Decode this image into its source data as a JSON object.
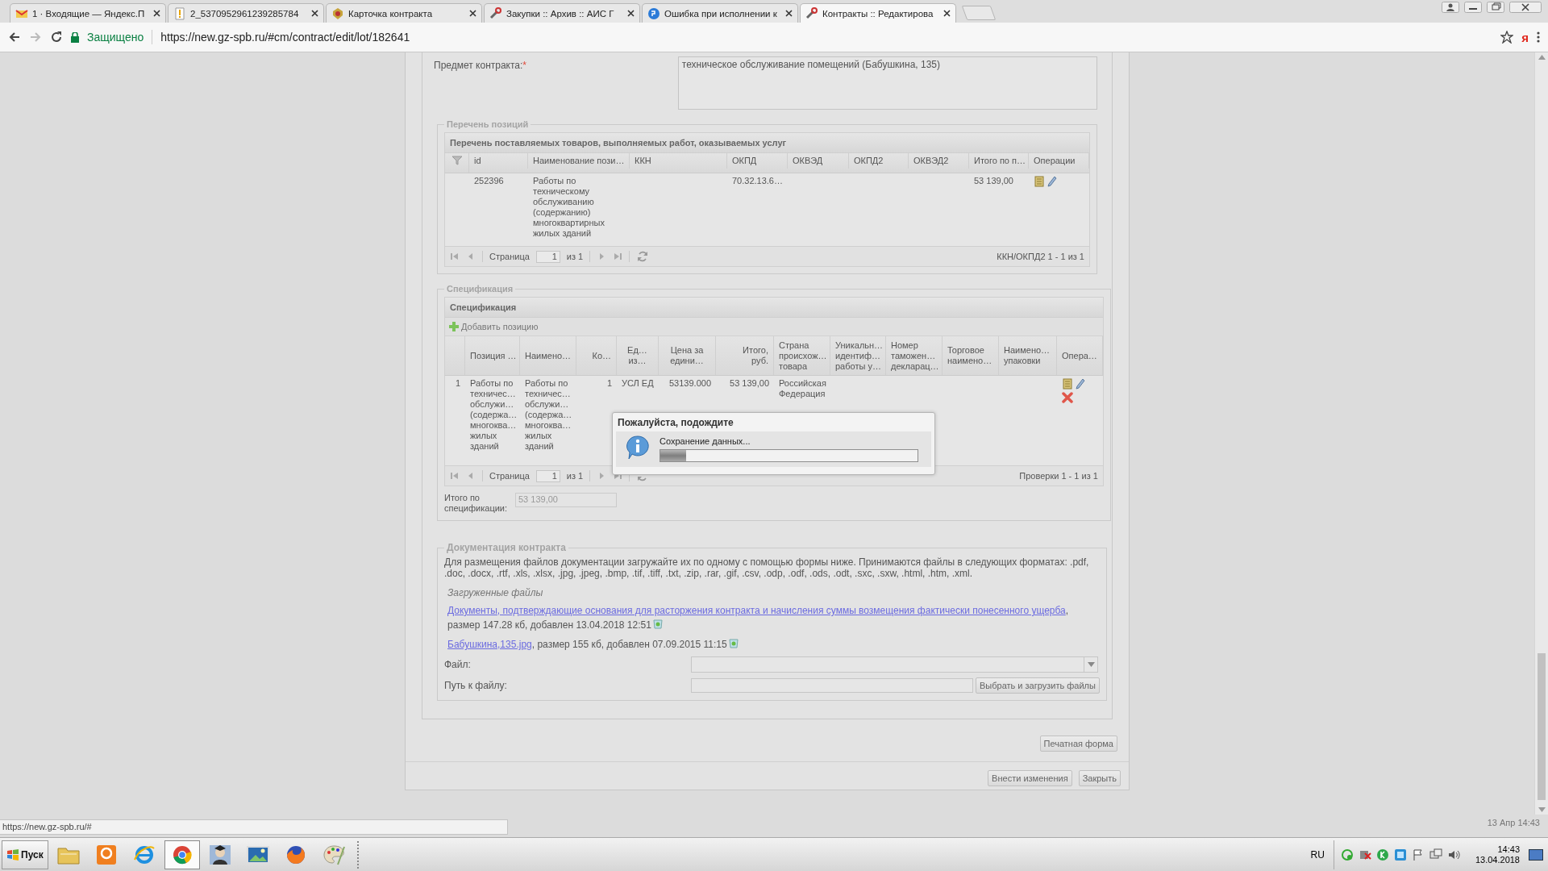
{
  "browser": {
    "tabs": [
      {
        "title": "1 · Входящие — Яндекс.П",
        "selected": false
      },
      {
        "title": "2_5370952961239285784",
        "selected": false
      },
      {
        "title": "Карточка контракта",
        "selected": false
      },
      {
        "title": "Закупки :: Архив :: АИС Г",
        "selected": false
      },
      {
        "title": "Ошибка при исполнении к",
        "selected": false
      },
      {
        "title": "Контракты :: Редактирова",
        "selected": true
      }
    ],
    "secure_label": "Защищено",
    "url": "https://new.gz-spb.ru/#cm/contract/edit/lot/182641",
    "extension_label": "я"
  },
  "form": {
    "subject": {
      "label": "Предмет контракта:",
      "required_mark": "*",
      "value": "техническое обслуживание помещений (Бабушкина, 135)"
    },
    "positions": {
      "legend": "Перечень позиций",
      "title": "Перечень поставляемых товаров, выполняемых работ, оказываемых услуг",
      "columns": [
        "id",
        "Наименование пози…",
        "ККН",
        "ОКПД",
        "ОКВЭД",
        "ОКПД2",
        "ОКВЭД2",
        "Итого по п…",
        "Операции"
      ],
      "rows": [
        {
          "cells": [
            "252396",
            "Работы по техническому обслуживанию (содержанию) многоквартирных жилых зданий",
            null,
            "70.32.13.6…",
            null,
            null,
            null,
            "53 139,00"
          ]
        }
      ],
      "pager": {
        "page_label": "Страница",
        "page": "1",
        "of": "из 1",
        "summary": "ККН/ОКПД2 1 - 1 из 1"
      }
    },
    "specification": {
      "legend": "Спецификация",
      "title": "Спецификация",
      "add_button": "Добавить позицию",
      "columns": [
        "Позиция …",
        "Наимено…",
        "Ко…",
        "Ед…\nиз…",
        "Цена за\nедини…",
        "Итого,\nруб.",
        "Страна\nпроисхож…\nтовара",
        "Уникальн…\nидентиф…\nработы у…",
        "Номер\nтаможен…\nдекларац…",
        "Торговое\nнаимено…",
        "Наимено…\nупаковки",
        "Опера…"
      ],
      "rows": [
        {
          "number": "1",
          "cells": [
            "Работы по\nтехничес…\nобслужи…\n(содержа…\nмногоква…\nжилых\nзданий",
            "Работы по\nтехничес…\nобслужи…\n(содержа…\nмногоква…\nжилых\nзданий",
            "1",
            "УСЛ ЕД",
            "53139.000",
            "53 139,00",
            "Российская\nФедерация",
            null,
            null,
            null,
            null
          ]
        }
      ],
      "pager": {
        "page_label": "Страница",
        "page": "1",
        "of": "из 1",
        "summary": "Проверки 1 - 1 из 1"
      },
      "total_label": "Итого по\nспецификации:",
      "total_value": "53 139,00"
    },
    "documents": {
      "legend": "Документация контракта",
      "note": "Для размещения файлов документации загружайте их по одному с помощью формы ниже. Принимаются файлы в следующих форматах: .pdf, .doc, .docx, .rtf, .xls, .xlsx, .jpg, .jpeg, .bmp, .tif, .tiff, .txt, .zip, .rar, .gif, .csv, .odp, .odf, .ods, .odt, .sxc, .sxw, .html, .htm, .xml.",
      "uploaded_label": "Загруженные файлы",
      "files": [
        {
          "link": "Документы, подтверждающие основания для расторжения контракта и начисления суммы возмещения фактически понесенного ущерба",
          "details": ", размер 147.28 кб, добавлен 13.04.2018 12:51"
        },
        {
          "link": "Бабушкина,135.jpg",
          "details": ", размер 155 кб, добавлен 07.09.2015 11:15"
        }
      ],
      "file_label": "Файл:",
      "path_label": "Путь к файлу:",
      "upload_button": "Выбрать и загрузить файлы"
    },
    "print_button": "Печатная форма",
    "buttons": [
      "Внести изменения",
      "Закрыть"
    ]
  },
  "dialog": {
    "title": "Пожалуйста, подождите",
    "message": "Сохранение данных...",
    "level": 0.1
  },
  "status_url": "https://new.gz-spb.ru/#",
  "notification_time": "13 Апр 14:43",
  "taskbar": {
    "start": "Пуск",
    "apps": [
      {
        "selected": false
      },
      {
        "selected": false
      },
      {
        "selected": false
      },
      {
        "selected": true
      },
      {
        "selected": false
      },
      {
        "selected": false
      },
      {
        "selected": false
      },
      {
        "selected": false
      }
    ],
    "language": "RU",
    "time": "14:43",
    "date": "13.04.2018"
  }
}
